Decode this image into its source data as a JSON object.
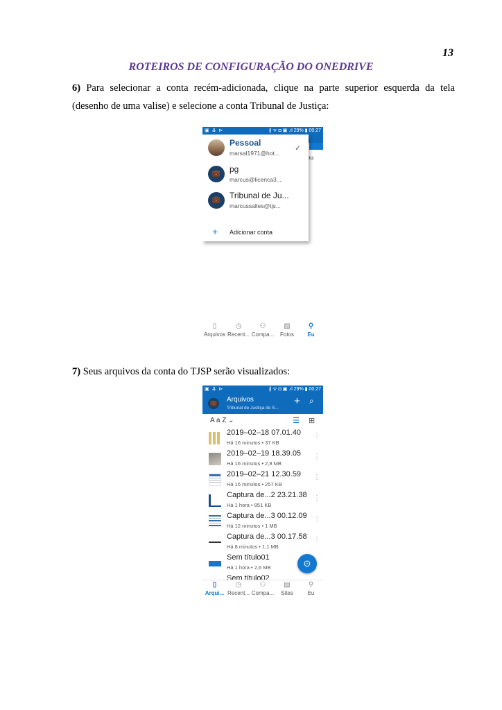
{
  "page": {
    "number": "13",
    "title": "ROTEIROS DE CONFIGURAÇÃO DO ONEDRIVE",
    "step6": {
      "num": "6)",
      "text": "Para selecionar a conta recém-adicionada, clique na parte superior esquerda da tela (desenho de uma valise) e selecione a conta Tribunal de Justiça:"
    },
    "step7": {
      "num": "7)",
      "text": "Seus arquivos da conta do TJSP serão visualizados:"
    }
  },
  "statusbar": {
    "left": "▣ ⇊ ⊳",
    "right": "∦ ᯤ ◘ ▣ .ıl 29% ▮ 00:27"
  },
  "phone1": {
    "behind_text": "ou",
    "accounts": [
      {
        "name": "Pessoal",
        "email": "marsal1971@hot...",
        "avatar": ""
      },
      {
        "name": "pg",
        "email": "marcus@licenca3...",
        "avatar": "briefcase-icon"
      },
      {
        "name": "Tribunal de Ju...",
        "email": "marcussalles@tjs...",
        "avatar": "briefcase-icon"
      }
    ],
    "add_account": "Adicionar conta",
    "tabs": [
      {
        "label": "Arquivos",
        "icon": "file-icon"
      },
      {
        "label": "Recent...",
        "icon": "clock-icon"
      },
      {
        "label": "Compa...",
        "icon": "people-icon"
      },
      {
        "label": "Fotos",
        "icon": "photo-icon"
      },
      {
        "label": "Eu",
        "icon": "person-icon"
      }
    ]
  },
  "phone2": {
    "header_title": "Arquivos",
    "header_subtitle": "Tribunal de Justiça de S...",
    "sort_label": "A a Z ⌄",
    "files": [
      {
        "name": "2019–02–18 07.01.40",
        "meta": "Há 16 minutos • 37 KB"
      },
      {
        "name": "2019–02–19 18.39.05",
        "meta": "Há 16 minutos • 2,8 MB"
      },
      {
        "name": "2019–02–21 12.30.59",
        "meta": "Há 16 minutos • 257 KB"
      },
      {
        "name": "Captura de...2 23.21.38",
        "meta": "Há 1 hora • 851 KB"
      },
      {
        "name": "Captura de...3 00.12.09",
        "meta": "Há 12 minutos • 1 MB"
      },
      {
        "name": "Captura de...3 00.17.58",
        "meta": "Há 8 minutos • 1,1 MB"
      },
      {
        "name": "Sem título01",
        "meta": "Há 1 hora • 2,6 MB"
      },
      {
        "name": "Sem título02",
        "meta": ""
      }
    ],
    "tabs": [
      {
        "label": "Arqui...",
        "icon": "file-icon"
      },
      {
        "label": "Recent...",
        "icon": "clock-icon"
      },
      {
        "label": "Compa...",
        "icon": "people-icon"
      },
      {
        "label": "Sites",
        "icon": "sites-icon"
      },
      {
        "label": "Eu",
        "icon": "person-icon"
      }
    ]
  },
  "colors": {
    "title": "#5b3a8e",
    "onedrive_blue": "#0f6cbd",
    "accent": "#1578d0"
  }
}
